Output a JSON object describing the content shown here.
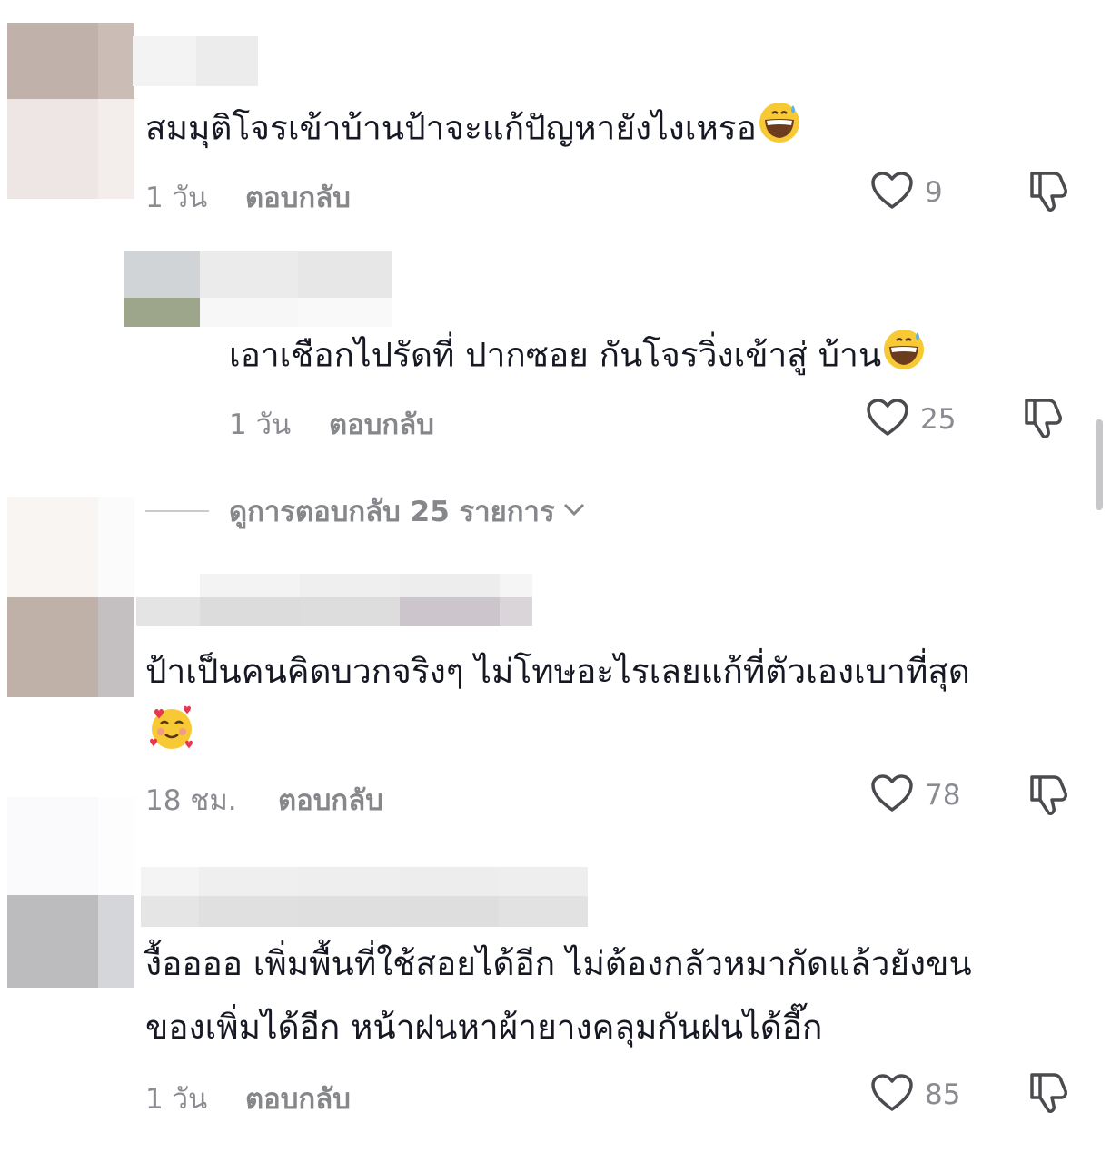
{
  "comments": [
    {
      "text": "สมมุติโจรเข้าบ้านป้าจะแก้ปัญหายังไงเหรอ",
      "emoji": "grinning-sweat-emoji",
      "time": "1 วัน",
      "reply_label": "ตอบกลับ",
      "likes": "9"
    },
    {
      "text": "เอาเชือกไปรัดที่ ปากซอย กันโจรวิ่งเข้าสู่ บ้าน",
      "emoji": "grinning-sweat-emoji",
      "time": "1 วัน",
      "reply_label": "ตอบกลับ",
      "likes": "25"
    },
    {
      "text": "ป้าเป็นคนคิดบวกจริงๆ ไม่โทษอะไรเลยแก้ที่ตัวเองเบาที่สุด",
      "emoji": "smiling-hearts-emoji",
      "time": "18 ชม.",
      "reply_label": "ตอบกลับ",
      "likes": "78"
    },
    {
      "text_line1": "งื้ออออ เพิ่มพื้นที่ใช้สอยได้อีก ไม่ต้องกลัวหมากัดแล้วยังขน",
      "text_line2": "ของเพิ่มได้อีก หน้าฝนหาผ้ายางคลุมกันฝนได้อี๊ก",
      "time": "1 วัน",
      "reply_label": "ตอบกลับ",
      "likes": "85"
    }
  ],
  "view_replies": {
    "label": "ดูการตอบกลับ 25 รายการ"
  },
  "icons": {
    "like": "heart-outline-icon",
    "dislike": "thumbs-down-icon",
    "expand": "chevron-down-icon"
  },
  "colors": {
    "text": "#161823",
    "muted": "#8a8b91",
    "icon": "#4a4a4f"
  }
}
